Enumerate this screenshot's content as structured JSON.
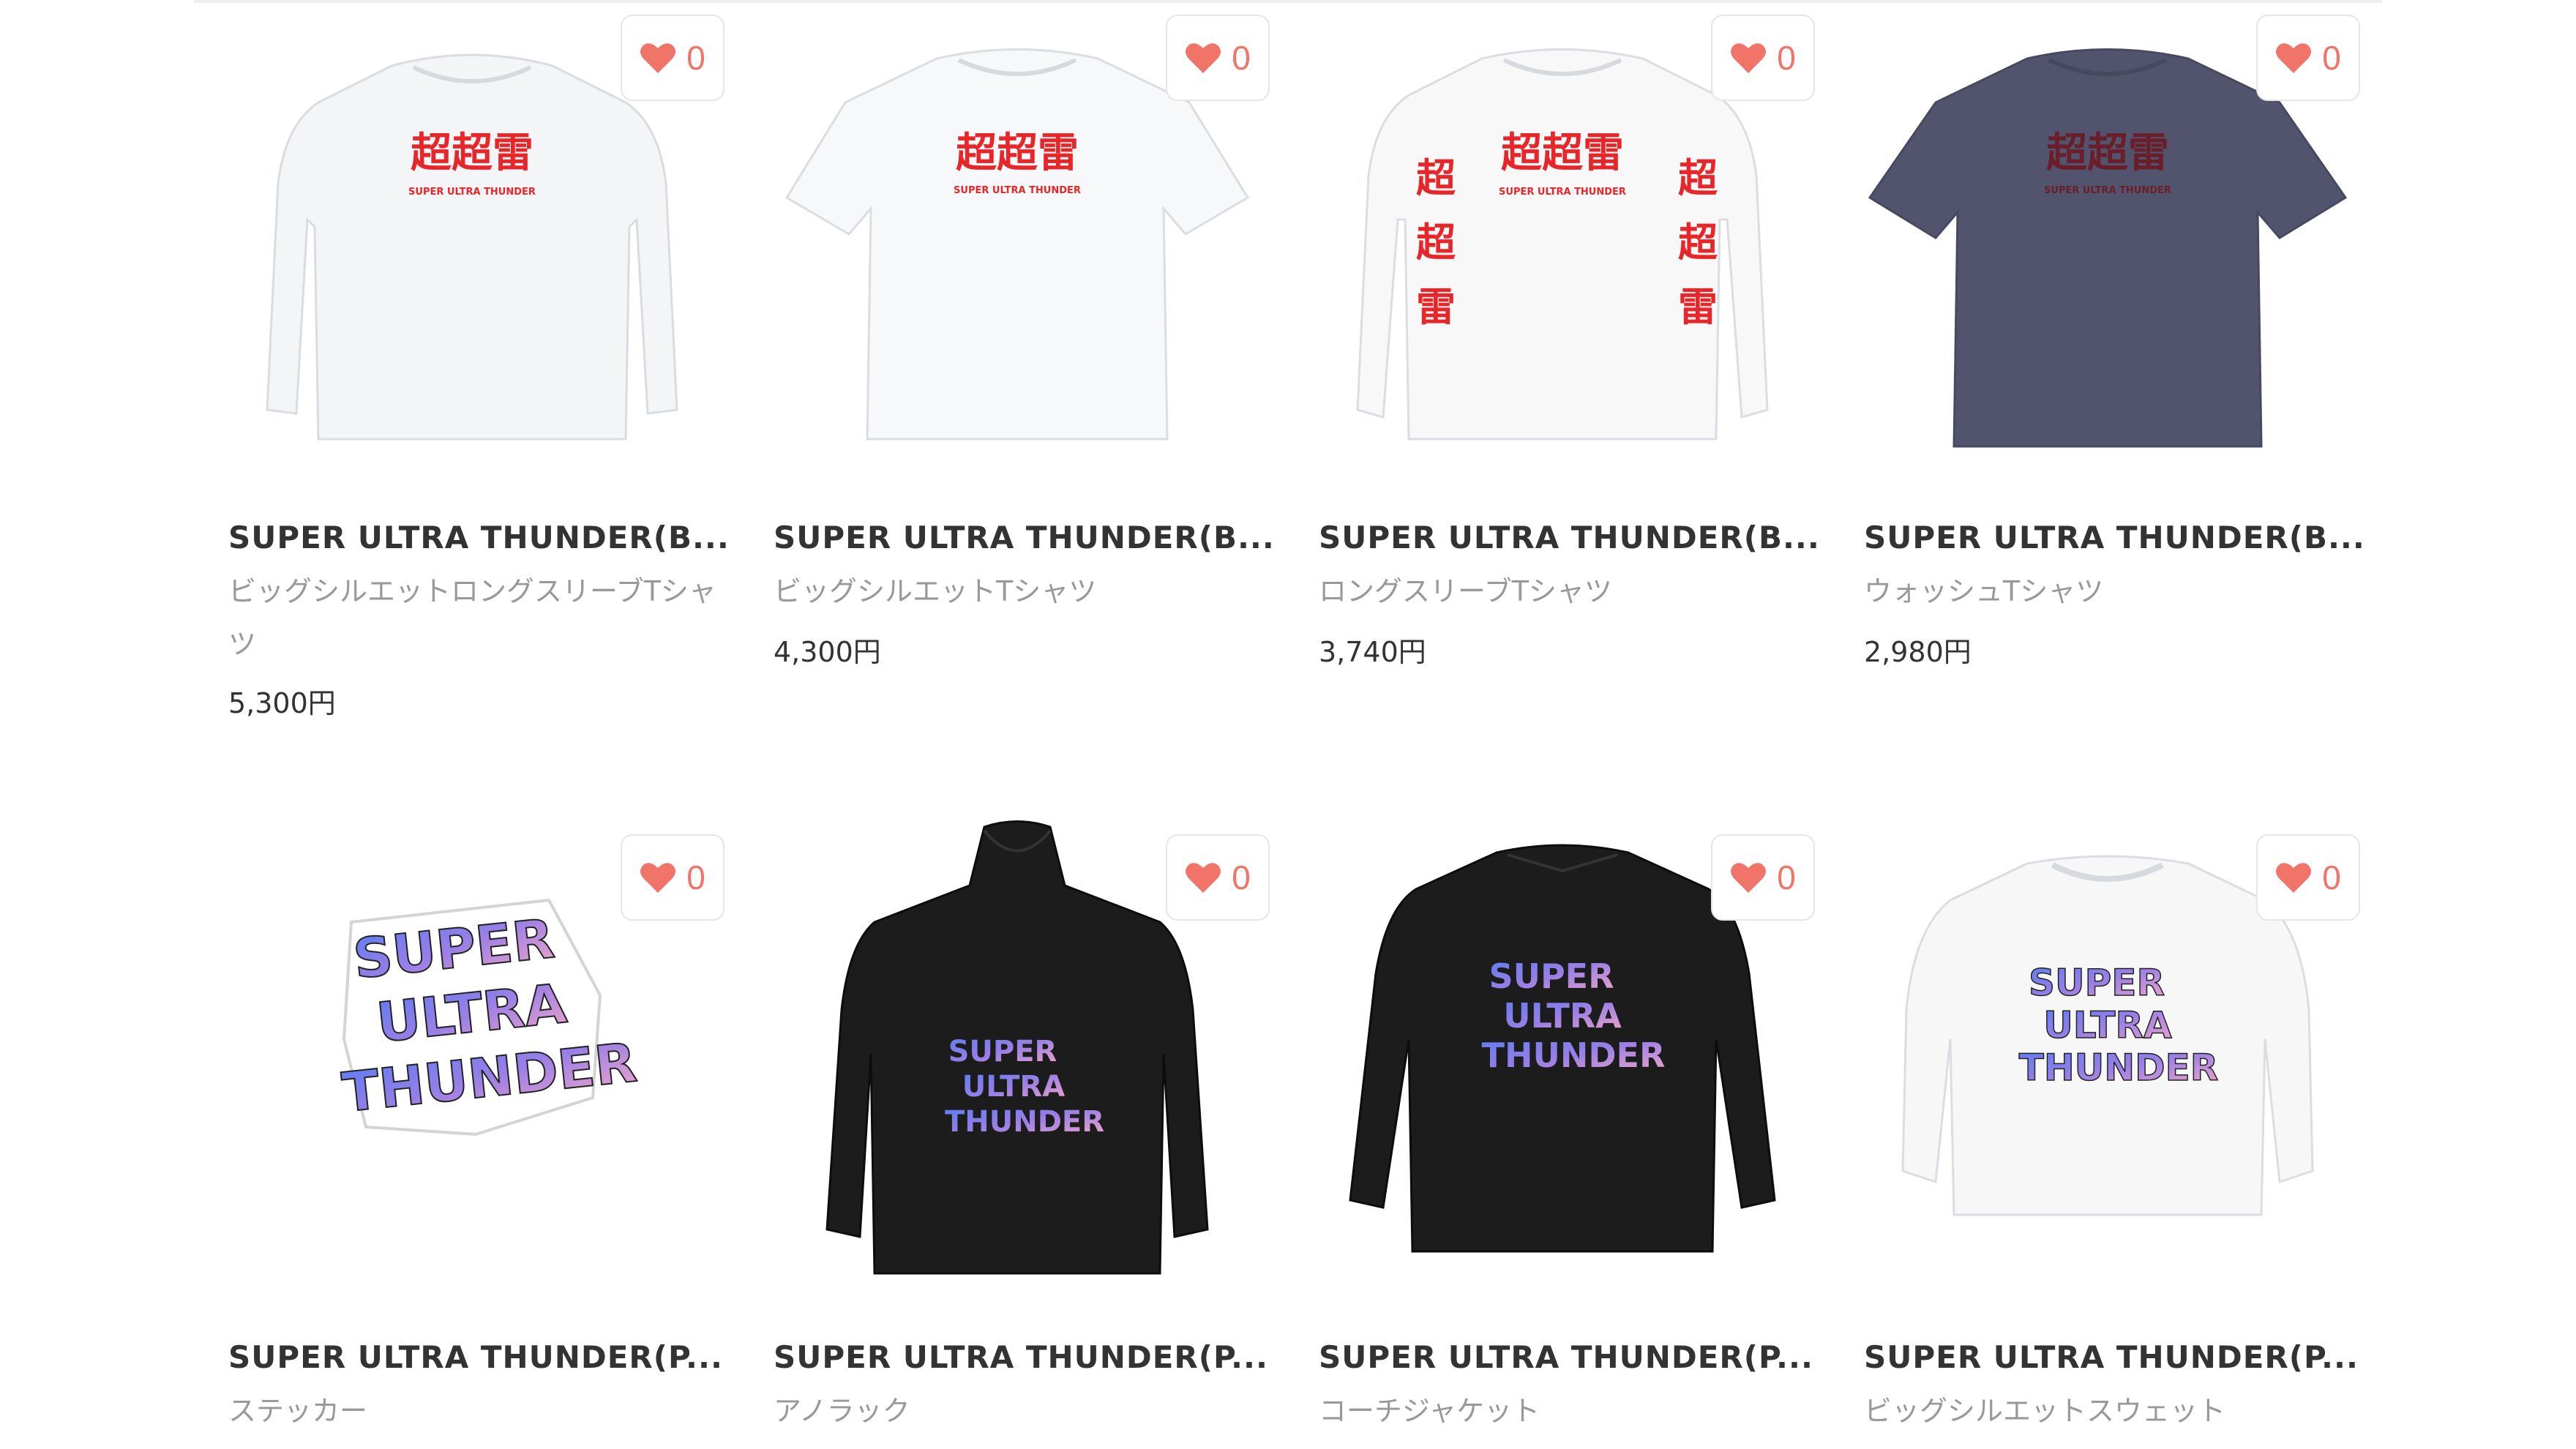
{
  "products": [
    {
      "title": "SUPER ULTRA THUNDER(B...",
      "type": "ビッグシルエットロングスリーブTシャツ",
      "price": "5,300円",
      "likes": "0",
      "image": "white-long-sleeve-tee"
    },
    {
      "title": "SUPER ULTRA THUNDER(B...",
      "type": "ビッグシルエットTシャツ",
      "price": "4,300円",
      "likes": "0",
      "image": "white-big-tee"
    },
    {
      "title": "SUPER ULTRA THUNDER(B...",
      "type": "ロングスリーブTシャツ",
      "price": "3,740円",
      "likes": "0",
      "image": "white-long-sleeve-tee-sleeve-print"
    },
    {
      "title": "SUPER ULTRA THUNDER(B...",
      "type": "ウォッシュTシャツ",
      "price": "2,980円",
      "likes": "0",
      "image": "navy-wash-tee"
    },
    {
      "title": "SUPER ULTRA THUNDER(P...",
      "type": "ステッカー",
      "price": "",
      "likes": "0",
      "image": "sticker"
    },
    {
      "title": "SUPER ULTRA THUNDER(P...",
      "type": "アノラック",
      "price": "",
      "likes": "0",
      "image": "black-anorak"
    },
    {
      "title": "SUPER ULTRA THUNDER(P...",
      "type": "コーチジャケット",
      "price": "",
      "likes": "0",
      "image": "black-coach-jacket"
    },
    {
      "title": "SUPER ULTRA THUNDER(P...",
      "type": "ビッグシルエットスウェット",
      "price": "",
      "likes": "0",
      "image": "white-sweatshirt"
    }
  ],
  "print": {
    "kanji": "超超雷",
    "kanji_single": [
      "超",
      "超",
      "雷"
    ],
    "subline": "SUPER ULTRA THUNDER",
    "logo_lines": [
      "SUPER",
      "ULTRA",
      "THUNDER"
    ]
  },
  "colors": {
    "heart": "#f07468",
    "kanji_red": "#e8262a",
    "navy": "#52546e"
  }
}
